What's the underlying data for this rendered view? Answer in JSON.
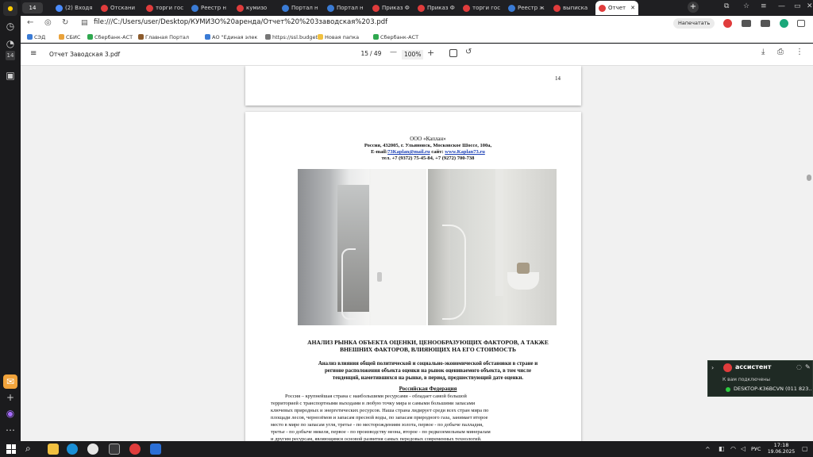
{
  "left_sidebar": {
    "tab_counter": "14",
    "badge": "14"
  },
  "tabs": [
    {
      "label": "(2) Входя",
      "color": "#4a8cff"
    },
    {
      "label": "Отскани",
      "color": "#e03c3c"
    },
    {
      "label": "торги гос",
      "color": "#e03c3c"
    },
    {
      "label": "Реестр н",
      "color": "#3a7bd5"
    },
    {
      "label": "кумизо",
      "color": "#e03c3c"
    },
    {
      "label": "Портал н",
      "color": "#3a7bd5"
    },
    {
      "label": "Портал н",
      "color": "#3a7bd5"
    },
    {
      "label": "Приказ Ф",
      "color": "#e03c3c"
    },
    {
      "label": "Приказ Ф",
      "color": "#e03c3c"
    },
    {
      "label": "торги гос",
      "color": "#e03c3c"
    },
    {
      "label": "Реестр ж",
      "color": "#3a7bd5"
    },
    {
      "label": "выписка",
      "color": "#e03c3c"
    },
    {
      "label": "Отчет",
      "color": "#e03c3c"
    }
  ],
  "address_bar": {
    "url": "file:///C:/Users/user/Desktop/КУМИЗО%20аренда/Отчет%20%203заводская%203.pdf",
    "action_button": "Напечатать"
  },
  "bookmarks": [
    {
      "label": "СЭД",
      "color": "#3a7bd5"
    },
    {
      "label": "СБИС",
      "color": "#e9a23b"
    },
    {
      "label": "Сбербанк-АСТ",
      "color": "#2fa84f"
    },
    {
      "label": "Главная Портал",
      "color": "#8b5a2b"
    },
    {
      "label": "АО \"Единая элек",
      "color": "#3a7bd5"
    },
    {
      "label": "https://ssl.budget",
      "color": "#777777"
    },
    {
      "label": "Новая папка",
      "color": "#f0c040"
    },
    {
      "label": "Сбербанк-АСТ",
      "color": "#2fa84f"
    }
  ],
  "pdf_toolbar": {
    "title": "Отчет Заводская 3.pdf",
    "page_current": "15",
    "page_total": "/ 49",
    "zoom": "100%",
    "zoom_out": "—",
    "zoom_in": "+"
  },
  "page_prev": {
    "page_number": "14"
  },
  "page_current": {
    "header_company": "ООО «Каплан»",
    "header_address": "Россия, 432005, г. Ульяновск, Московское Шоссе, 100а,",
    "header_email_prefix": "E-mail:",
    "header_email": "73Kaplan@mail.ru",
    "header_site_prefix": " сайт: ",
    "header_site": "www.Kaplan73.ru",
    "header_phone": "тел. +7 (9372) 75-45-84, +7 (9272) 700-738",
    "title_line1": "АНАЛИЗ РЫНКА ОБЪЕКТА ОЦЕНКИ, ЦЕНООБРАЗУЮЩИХ ФАКТОРОВ, А ТАКЖЕ",
    "title_line2": "ВНЕШНИХ ФАКТОРОВ, ВЛИЯЮЩИХ НА ЕГО СТОИМОСТЬ",
    "subtitle_line1": "Анализ влияния общей политической и социально-экономической обстановки в стране и",
    "subtitle_line2": "регионе расположения объекта оценки на рынок оцениваемого объекта, в том числе",
    "subtitle_line3": "тенденций, наметившихся на рынке, в период, предшествующий дате оценки.",
    "section_heading": "Российская Федерация",
    "para_lines": [
      "Россия – крупнейшая страна с наибольшими ресурсами - обладает самой большой",
      "территорией с транспортными выходами в любую точку мира и самыми большими запасами",
      "ключевых природных и энергетических ресурсов. Наша страна лидирует среди всех стран мира по",
      "площади лесов, чернозёмов и запасам пресной воды, по запасам природного газа, занимает второе",
      "место в мире по запасам угля, третье - по месторождениям золота, первое - по добыче палладия,",
      "третье - по добыче никеля, первое - по производству неона, второе - по редкоземельным минералам",
      "и другим ресурсам, являющимся основой развития самых передовых современных технологий."
    ]
  },
  "assistant_popup": {
    "title": "ассистент",
    "subtitle": "К вам подключены",
    "device": "DESKTOP-K36BCVN (011 823..."
  },
  "taskbar": {
    "language": "РУС",
    "time": "17:18",
    "date": "19.06.2025"
  },
  "colors": {
    "accent_red": "#e03c3c",
    "link_blue": "#1a3fb5",
    "taskbar": "#1c1c1e"
  }
}
